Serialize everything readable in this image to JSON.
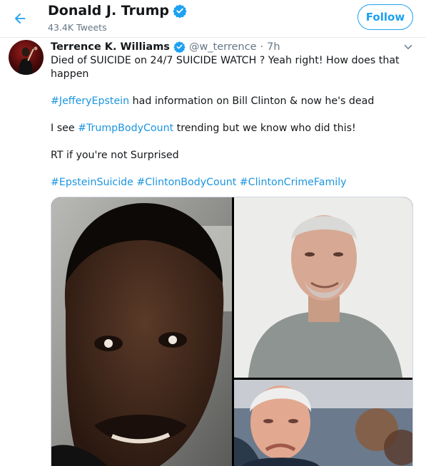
{
  "header": {
    "back_icon": "arrow-left-icon",
    "title": "Donald J. Trump",
    "tweets_count": "43.4K Tweets",
    "follow_label": "Follow"
  },
  "tweet": {
    "name": "Terrence K. Williams",
    "handle": "@w_terrence",
    "separator": "·",
    "time": "7h",
    "line1": "Died of SUICIDE on 24/7 SUICIDE WATCH ? Yeah right! How does that",
    "line2": "happen",
    "hashtag_epstein": "#JefferyEpstein",
    "line3_rest": " had information on Bill Clinton & now he's dead",
    "line4_pre": "I see ",
    "hashtag_bodycount": "#TrumpBodyCount",
    "line4_rest": " trending but we know who did this!",
    "line5": "RT if you're not Surprised",
    "hashtags": [
      "#EpsteinSuicide",
      "#ClintonBodyCount",
      "#ClintonCrimeFamily"
    ]
  },
  "colors": {
    "link": "#1b95e0",
    "accent": "#1da1f2",
    "muted": "#657786",
    "verified": "#1da1f2"
  }
}
